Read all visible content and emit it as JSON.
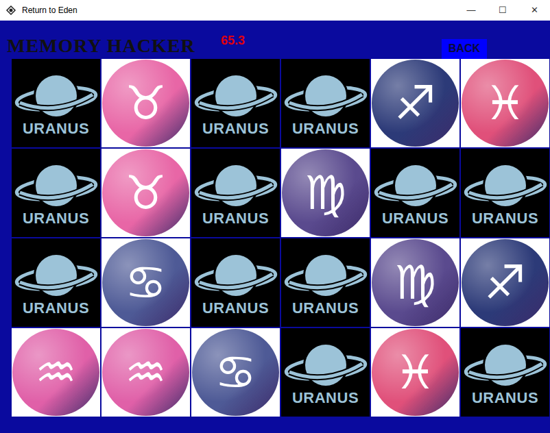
{
  "window": {
    "title": "Return to Eden",
    "controls": [
      "—",
      "☐",
      "✕"
    ]
  },
  "header": {
    "title": "MEMORY HACKER",
    "timer": "65.3",
    "back_button": "BACK"
  },
  "cards": [
    [
      {
        "kind": "back",
        "label": "URANUS"
      },
      {
        "kind": "face",
        "symbol": "♉",
        "color": "#e866a6"
      },
      {
        "kind": "back",
        "label": "URANUS"
      },
      {
        "kind": "back",
        "label": "URANUS"
      },
      {
        "kind": "face",
        "symbol": "♐",
        "color": "#2c3a78"
      },
      {
        "kind": "face",
        "symbol": "♓",
        "color": "#e0507a"
      }
    ],
    [
      {
        "kind": "back",
        "label": "URANUS"
      },
      {
        "kind": "face",
        "symbol": "♉",
        "color": "#e866a6"
      },
      {
        "kind": "back",
        "label": "URANUS"
      },
      {
        "kind": "face",
        "symbol": "♍",
        "color": "#5a4a8e"
      },
      {
        "kind": "back",
        "label": "URANUS"
      },
      {
        "kind": "back",
        "label": "URANUS"
      }
    ],
    [
      {
        "kind": "back",
        "label": "URANUS"
      },
      {
        "kind": "face",
        "symbol": "♋",
        "color": "#4e5a96"
      },
      {
        "kind": "back",
        "label": "URANUS"
      },
      {
        "kind": "back",
        "label": "URANUS"
      },
      {
        "kind": "face",
        "symbol": "♍",
        "color": "#5a4a8e"
      },
      {
        "kind": "face",
        "symbol": "♐",
        "color": "#2c3a78"
      }
    ],
    [
      {
        "kind": "face",
        "symbol": "♒",
        "color": "#e060a8"
      },
      {
        "kind": "face",
        "symbol": "♒",
        "color": "#e060a8"
      },
      {
        "kind": "face",
        "symbol": "♋",
        "color": "#4e5a96"
      },
      {
        "kind": "back",
        "label": "URANUS"
      },
      {
        "kind": "face",
        "symbol": "♓",
        "color": "#e0507a"
      },
      {
        "kind": "back",
        "label": "URANUS"
      }
    ]
  ]
}
